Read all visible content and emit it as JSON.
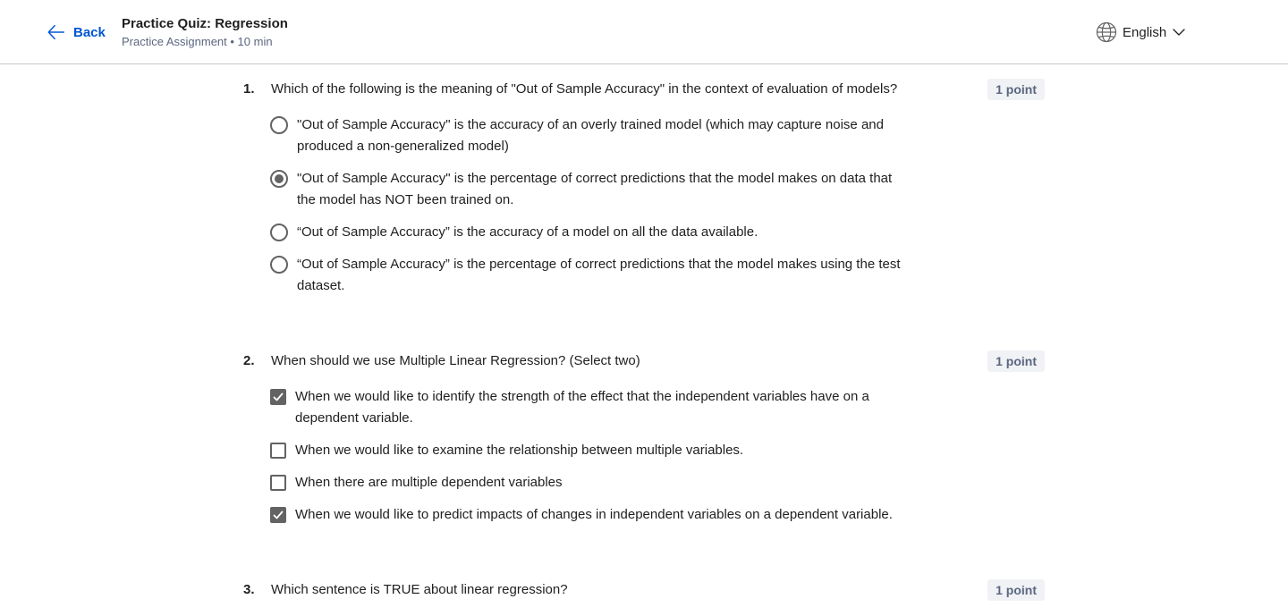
{
  "header": {
    "back_label": "Back",
    "title": "Practice Quiz: Regression",
    "subtitle": "Practice Assignment • 10 min",
    "language": "English"
  },
  "questions": [
    {
      "number": "1.",
      "text": "Which of the following is the meaning of \"Out of Sample Accuracy\" in the context of evaluation of models?",
      "points": "1 point",
      "type": "radio",
      "options": [
        {
          "label": "\"Out of Sample Accuracy\" is the accuracy of an overly trained model (which may capture noise and produced a non-generalized model)",
          "selected": false
        },
        {
          "label": "\"Out of Sample Accuracy\" is the percentage of correct predictions that the model makes on data that the model has NOT been trained on.",
          "selected": true
        },
        {
          "label": "“Out of Sample Accuracy” is the accuracy of a model on all the data available.",
          "selected": false
        },
        {
          "label": "“Out of Sample Accuracy” is the percentage of correct predictions that the model makes using the test dataset.",
          "selected": false
        }
      ]
    },
    {
      "number": "2.",
      "text": "When should we use Multiple Linear Regression? (Select two)",
      "points": "1 point",
      "type": "checkbox",
      "options": [
        {
          "label": "When we would like to identify the strength of the effect that the independent variables have on a dependent variable.",
          "selected": true
        },
        {
          "label": "When we would like to examine the relationship between multiple variables.",
          "selected": false
        },
        {
          "label": "When there are multiple dependent variables",
          "selected": false
        },
        {
          "label": "When we would like to predict impacts of changes in independent variables on a dependent variable.",
          "selected": true
        }
      ]
    },
    {
      "number": "3.",
      "text": "Which sentence is TRUE about linear regression?",
      "points": "1 point",
      "type": "radio",
      "options": []
    }
  ]
}
